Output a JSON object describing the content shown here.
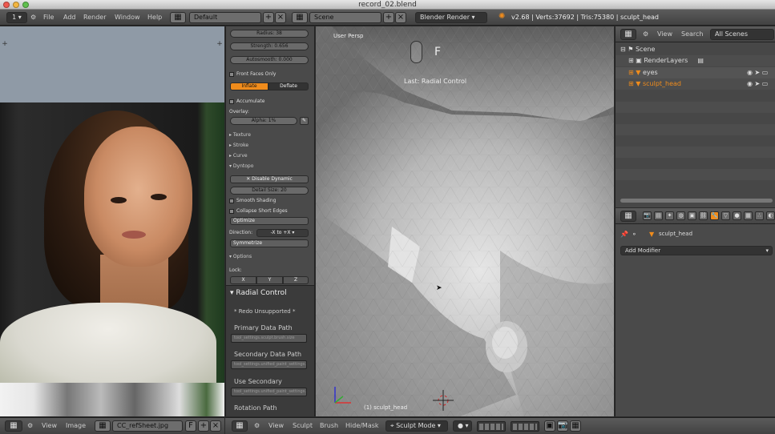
{
  "window": {
    "title": "record_02.blend"
  },
  "info_header": {
    "editor_icon": "1",
    "menus": [
      "File",
      "Add",
      "Render",
      "Window",
      "Help"
    ],
    "screen_layout": "Default",
    "scene": "Scene",
    "render_engine": "Blender Render",
    "stats": "v2.68 | Verts:37692 | Tris:75380 | sculpt_head"
  },
  "tool_shelf": {
    "radius": "Radius: 38",
    "strength": "Strength: 0.656",
    "autosmooth": "Autosmooth: 0.000",
    "front_faces": "Front Faces Only",
    "inflate": "Inflate",
    "deflate": "Deflate",
    "accumulate": "Accumulate",
    "overlay": "Overlay:",
    "alpha": "Alpha: 1%",
    "sections": {
      "texture": "Texture",
      "stroke": "Stroke",
      "curve": "Curve",
      "dyntopo": "Dyntopo",
      "options": "Options"
    },
    "disable_dynamic": "Disable Dynamic",
    "detail_size": "Detail Size: 20",
    "smooth_shading": "Smooth Shading",
    "collapse_edges": "Collapse Short Edges",
    "optimize": "Optimize",
    "direction": "Direction:",
    "direction_value": "-X to +X",
    "symmetrize": "Symmetrize",
    "lock": "Lock:",
    "lock_axes": [
      "X",
      "Y",
      "Z"
    ]
  },
  "radial_control": {
    "title": "Radial Control",
    "redo_unsupported": "* Redo Unsupported *",
    "primary_label": "Primary Data Path",
    "primary_value": "tool_settings.sculpt.brush.size",
    "secondary_label": "Secondary Data Path",
    "secondary_value": "tool_settings.unified_paint_settings.size",
    "use_secondary_label": "Use Secondary",
    "use_secondary_value": "tool_settings.unified_paint_settings.use_unified_size",
    "rotation_label": "Rotation Path"
  },
  "viewport": {
    "view_name": "User Persp",
    "key_hint": "F",
    "last_op": "Last: Radial Control",
    "object_label": "(1) sculpt_head"
  },
  "outliner": {
    "menus": [
      "View",
      "Search"
    ],
    "filter": "All Scenes",
    "rows": [
      "Scene",
      "RenderLayers",
      "eyes",
      "sculpt_head"
    ]
  },
  "properties": {
    "object_name": "sculpt_head",
    "add_modifier": "Add Modifier"
  },
  "image_editor_header": {
    "menus": [
      "View",
      "Image"
    ],
    "image_name": "CC_refSheet.jpg",
    "fake_user": "F"
  },
  "view3d_header": {
    "menus": [
      "View",
      "Sculpt",
      "Brush",
      "Hide/Mask"
    ],
    "mode": "Sculpt Mode"
  },
  "colors": {
    "accent": "#f08c1c",
    "panel": "#4a4a4a",
    "header": "#4f4f4f"
  }
}
